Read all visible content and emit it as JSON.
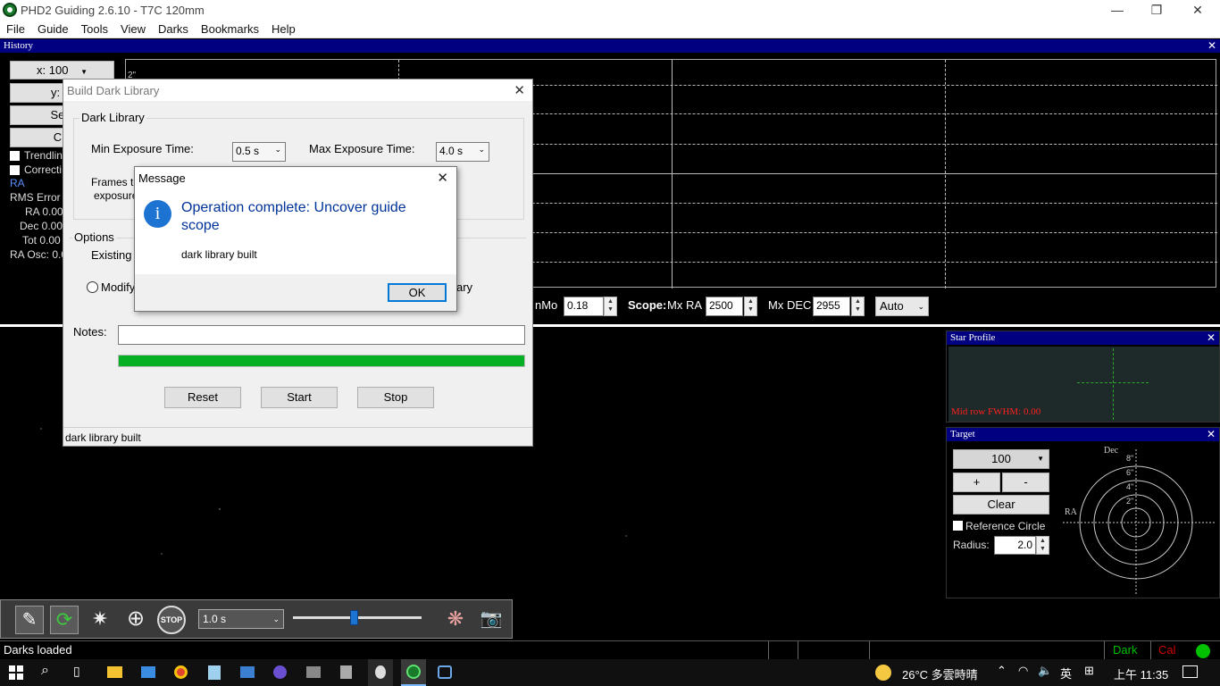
{
  "window": {
    "title": "PHD2 Guiding 2.6.10 - T7C 120mm",
    "controls": [
      "—",
      "❐",
      "✕"
    ]
  },
  "menu": [
    "File",
    "Guide",
    "Tools",
    "View",
    "Darks",
    "Bookmarks",
    "Help"
  ],
  "history": {
    "title": "History",
    "x_scale": "x: 100",
    "y_scale": "y: +/",
    "settings_label": "Setti",
    "clear_label": "Cle",
    "trendlines_label": "Trendlin",
    "correction_label": "Correcti",
    "ra_legend": "RA",
    "rms_error_label": "RMS Error",
    "ra_value": "RA 0.00",
    "dec_value": "Dec 0.00",
    "tot_value": "Tot 0.00",
    "ra_osc": "RA Osc: 0.0",
    "y_tick": "2\"",
    "minmo_label": "nMo",
    "minmo_value": "0.18",
    "scope_label": "Scope:",
    "mxra_label": "Mx RA",
    "mxra_value": "2500",
    "mxdec_label": "Mx DEC",
    "mxdec_value": "2955",
    "auto_value": "Auto"
  },
  "build_dark": {
    "title": "Build Dark Library",
    "group_label": "Dark Library",
    "min_exp_label": "Min Exposure Time:",
    "min_exp_value": "0.5 s",
    "max_exp_label": "Max Exposure Time:",
    "max_exp_value": "4.0 s",
    "frames_label_1": "Frames to",
    "frames_label_2": "exposure",
    "options_label": "Options",
    "existing_label": "Existing d",
    "modify_label": "Modify",
    "library_suffix": "ary",
    "notes_label": "Notes:",
    "notes_value": "",
    "progress": 1.0,
    "reset_label": "Reset",
    "start_label": "Start",
    "stop_label": "Stop",
    "status": "dark library built"
  },
  "message": {
    "title": "Message",
    "heading": "Operation complete: Uncover guide scope",
    "body": "dark library built",
    "ok_label": "OK"
  },
  "star_profile": {
    "title": "Star Profile",
    "fwhm": "Mid row FWHM: 0.00"
  },
  "target": {
    "title": "Target",
    "scale_value": "100",
    "plus_label": "+",
    "minus_label": "-",
    "clear_label": "Clear",
    "ref_circle_label": "Reference Circle",
    "radius_label": "Radius:",
    "radius_value": "2.0",
    "dec_label": "Dec",
    "ra_label": "RA",
    "ring_labels": [
      "8\"",
      "6\"",
      "4\"",
      "2\""
    ]
  },
  "toolbar": {
    "exposure_value": "1.0 s",
    "gamma": 0.47
  },
  "status": {
    "text": "Darks loaded",
    "dark": "Dark",
    "cal": "Cal"
  },
  "taskbar": {
    "weather": "26°C  多雲時晴",
    "ime": "英",
    "clock": "上午 11:35"
  },
  "colors": {
    "accent_blue": "#000080",
    "progress_green": "#06b025",
    "status_green": "#00c000",
    "status_red": "#d00000",
    "profile_red": "#ff2020",
    "info_blue": "#1d73d2"
  }
}
